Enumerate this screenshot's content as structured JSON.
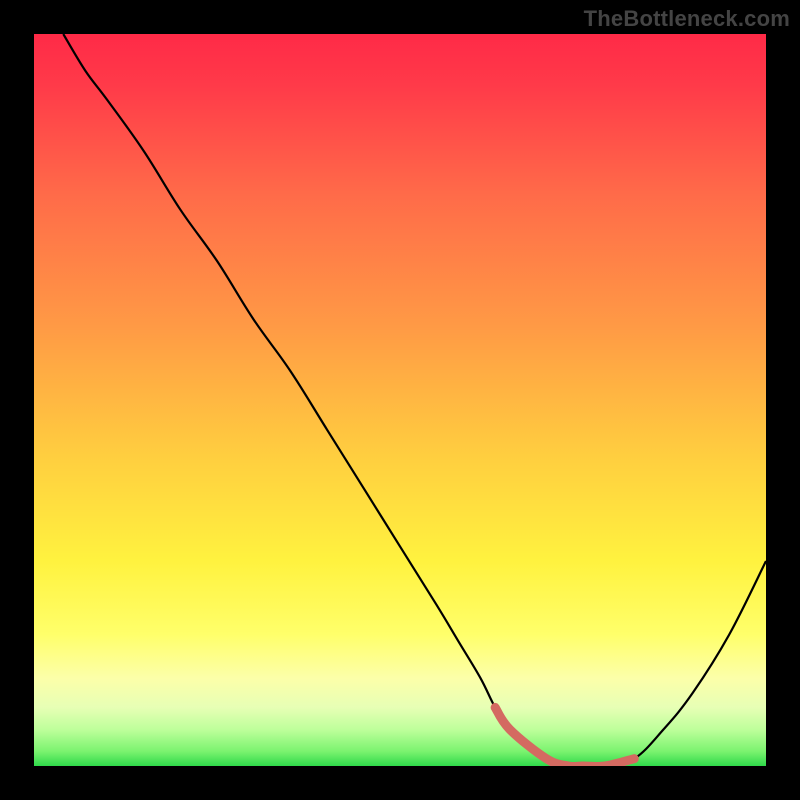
{
  "watermark": "TheBottleneck.com",
  "chart_data": {
    "type": "line",
    "title": "",
    "xlabel": "",
    "ylabel": "",
    "xlim": [
      0,
      100
    ],
    "ylim": [
      0,
      100
    ],
    "notes": "Gradient background from red (top) through orange/yellow to green (bottom). Black curve descends from top-left, reaches a flat minimum with a short salmon-red highlighted segment near the bottom-right, then rises toward the right edge.",
    "series": [
      {
        "name": "curve",
        "x": [
          4,
          7,
          10,
          15,
          20,
          25,
          30,
          35,
          40,
          45,
          50,
          55,
          58,
          61,
          63,
          65,
          70,
          73,
          75,
          78,
          82,
          86,
          90,
          95,
          100
        ],
        "values": [
          100,
          95,
          91,
          84,
          76,
          69,
          61,
          54,
          46,
          38,
          30,
          22,
          17,
          12,
          8,
          5,
          1,
          0,
          0,
          0,
          1,
          5,
          10,
          18,
          28
        ]
      },
      {
        "name": "highlight_segment",
        "x": [
          63,
          65,
          70,
          73,
          75,
          78,
          82
        ],
        "values": [
          8,
          5,
          1,
          0,
          0,
          0,
          1
        ]
      }
    ],
    "gradient_stops": [
      {
        "offset": 0.0,
        "color": "#ff2a47"
      },
      {
        "offset": 0.07,
        "color": "#ff3a49"
      },
      {
        "offset": 0.22,
        "color": "#ff6b49"
      },
      {
        "offset": 0.4,
        "color": "#ff9a45"
      },
      {
        "offset": 0.58,
        "color": "#ffcf3f"
      },
      {
        "offset": 0.72,
        "color": "#fff23f"
      },
      {
        "offset": 0.82,
        "color": "#ffff6a"
      },
      {
        "offset": 0.88,
        "color": "#fcffa9"
      },
      {
        "offset": 0.92,
        "color": "#e7ffb5"
      },
      {
        "offset": 0.95,
        "color": "#beff9b"
      },
      {
        "offset": 0.98,
        "color": "#7bf36f"
      },
      {
        "offset": 1.0,
        "color": "#2fd94a"
      }
    ],
    "curve_color": "#000000",
    "highlight_color": "#d46a61"
  }
}
